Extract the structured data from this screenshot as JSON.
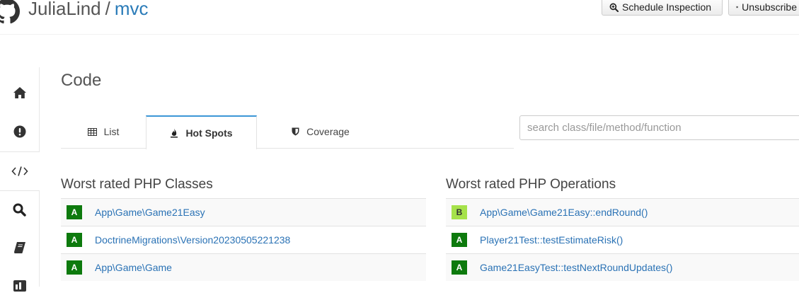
{
  "header": {
    "owner": "JuliaLind",
    "separator": "/",
    "repo": "mvc",
    "schedule_label": "Schedule Inspection",
    "unsubscribe_label": "Unsubscribe"
  },
  "sidebar": {
    "items": [
      {
        "icon": "home-icon"
      },
      {
        "icon": "issues-icon"
      },
      {
        "icon": "code-icon",
        "active": true
      },
      {
        "icon": "search-icon"
      },
      {
        "icon": "book-icon"
      },
      {
        "icon": "dashboard-icon"
      }
    ]
  },
  "main": {
    "title": "Code",
    "tabs": [
      {
        "label": "List",
        "icon": "table-icon"
      },
      {
        "label": "Hot Spots",
        "icon": "fire-icon",
        "active": true
      },
      {
        "label": "Coverage",
        "icon": "shield-icon"
      }
    ],
    "search": {
      "placeholder": "search class/file/method/function",
      "value": ""
    },
    "classes": {
      "title": "Worst rated PHP Classes",
      "items": [
        {
          "grade": "A",
          "name": "App\\Game\\Game21Easy"
        },
        {
          "grade": "A",
          "name": "DoctrineMigrations\\Version20230505221238"
        },
        {
          "grade": "A",
          "name": "App\\Game\\Game"
        }
      ]
    },
    "operations": {
      "title": "Worst rated PHP Operations",
      "items": [
        {
          "grade": "B",
          "name": "App\\Game\\Game21Easy::endRound()"
        },
        {
          "grade": "A",
          "name": "Player21Test::testEstimateRisk()"
        },
        {
          "grade": "A",
          "name": "Game21EasyTest::testNextRoundUpdates()"
        }
      ]
    }
  },
  "colors": {
    "link": "#2a72b5",
    "grade_a": "#0d7a0d",
    "grade_b": "#a6e24a",
    "tab_active_border": "#3c97d6"
  }
}
